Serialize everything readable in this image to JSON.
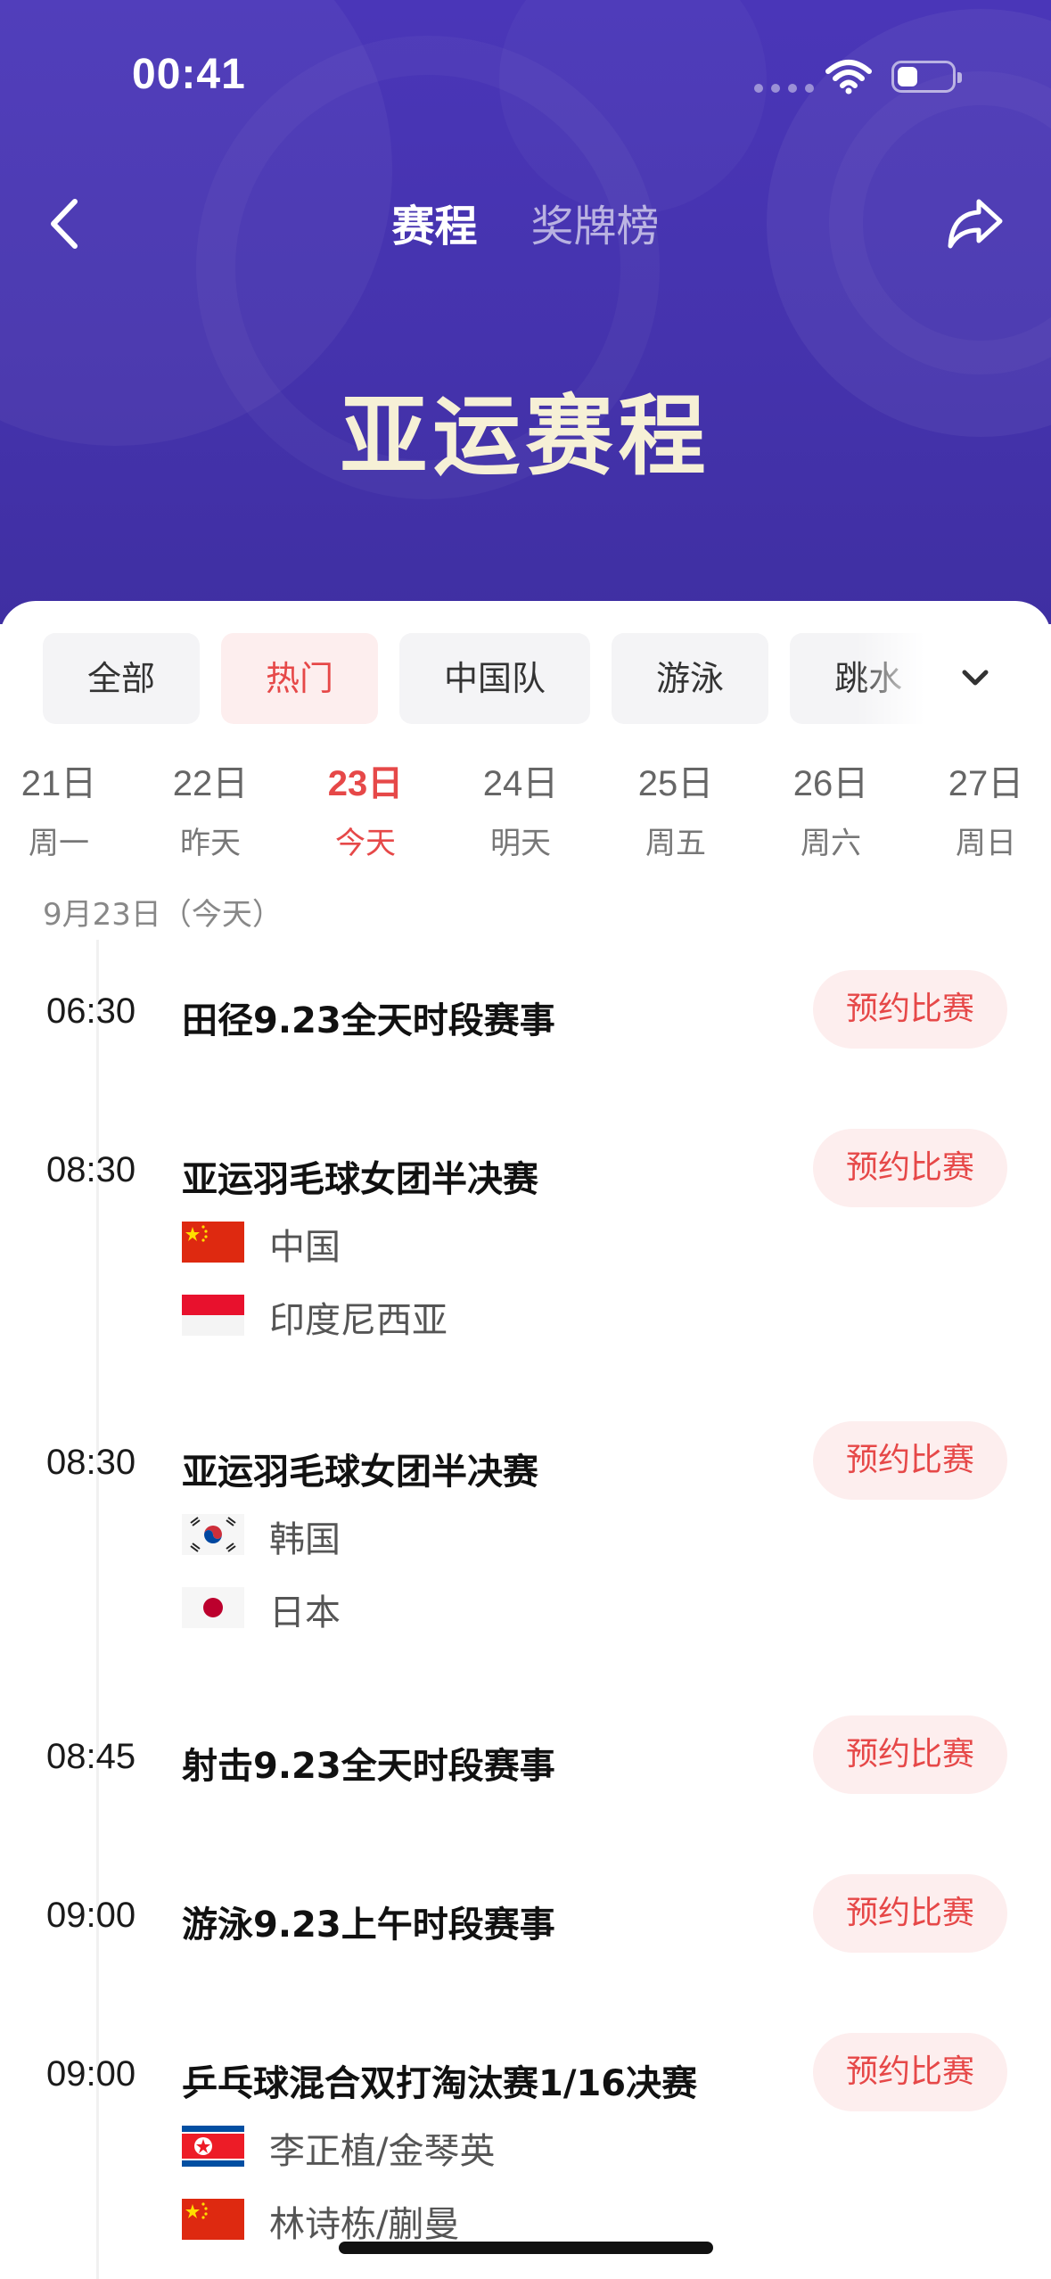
{
  "status_bar": {
    "time": "00:41"
  },
  "nav": {
    "tabs": [
      {
        "label": "赛程",
        "active": true
      },
      {
        "label": "奖牌榜",
        "active": false
      }
    ],
    "back_icon": "chevron-left-icon",
    "share_icon": "share-arrow-icon"
  },
  "hero": {
    "title": "亚运赛程"
  },
  "filter_chips": [
    {
      "label": "全部",
      "active": false
    },
    {
      "label": "热门",
      "active": true
    },
    {
      "label": "中国队",
      "active": false
    },
    {
      "label": "游泳",
      "active": false
    },
    {
      "label": "跳水",
      "active": false
    }
  ],
  "dates": [
    {
      "day": "21日",
      "sub": "周一",
      "active": false
    },
    {
      "day": "22日",
      "sub": "昨天",
      "active": false
    },
    {
      "day": "23日",
      "sub": "今天",
      "active": true
    },
    {
      "day": "24日",
      "sub": "明天",
      "active": false
    },
    {
      "day": "25日",
      "sub": "周五",
      "active": false
    },
    {
      "day": "26日",
      "sub": "周六",
      "active": false
    },
    {
      "day": "27日",
      "sub": "周日",
      "active": false
    }
  ],
  "section_date": "9月23日（今天）",
  "book_label": "预约比赛",
  "events": [
    {
      "time": "06:30",
      "title": "田径9.23全天时段赛事",
      "teams": []
    },
    {
      "time": "08:30",
      "title": "亚运羽毛球女团半决赛",
      "teams": [
        {
          "name": "中国",
          "flag": "china"
        },
        {
          "name": "印度尼西亚",
          "flag": "indonesia"
        }
      ]
    },
    {
      "time": "08:30",
      "title": "亚运羽毛球女团半决赛",
      "teams": [
        {
          "name": "韩国",
          "flag": "korea"
        },
        {
          "name": "日本",
          "flag": "japan"
        }
      ]
    },
    {
      "time": "08:45",
      "title": "射击9.23全天时段赛事",
      "teams": []
    },
    {
      "time": "09:00",
      "title": "游泳9.23上午时段赛事",
      "teams": []
    },
    {
      "time": "09:00",
      "title": "乒乓球混合双打淘汰赛1/16决赛",
      "teams": [
        {
          "name": "李正植/金琴英",
          "flag": "north-korea"
        },
        {
          "name": "林诗栋/蒯曼",
          "flag": "china"
        }
      ]
    }
  ],
  "colors": {
    "accent": "#e64848",
    "header": "#4533ad",
    "chip_bg": "#f4f4f6"
  }
}
